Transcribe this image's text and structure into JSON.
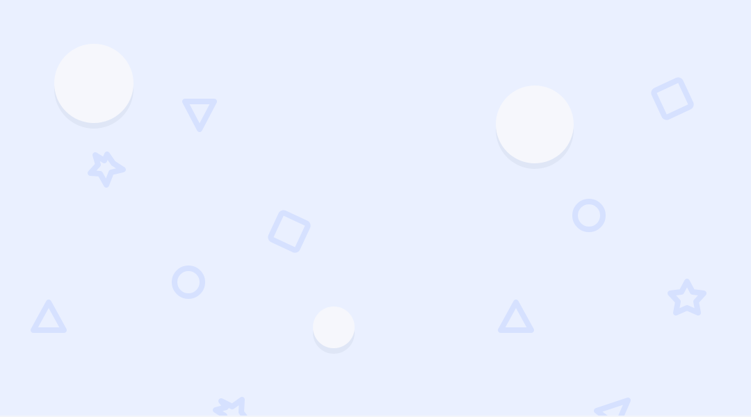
{
  "background": {
    "color": "#eaf0ff",
    "shape_color": "#d6e1ff",
    "bubble_color": "#f6f7fc",
    "bubble_shadow": "#dfe6f6"
  },
  "icons": {
    "circles": "circle-outline-icon",
    "squares": "square-outline-icon",
    "triangles": "triangle-outline-icon",
    "stars": "star-outline-icon",
    "bubbles": "bubble"
  }
}
